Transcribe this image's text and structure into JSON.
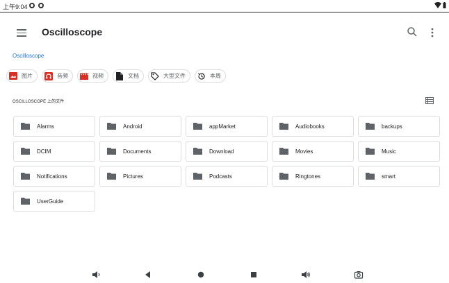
{
  "status_bar": {
    "time": "上午9:04",
    "icons": [
      "app-notification-icon",
      "app-notification-icon",
      "wifi-icon",
      "battery-icon"
    ]
  },
  "app_bar": {
    "title": "Oscilloscope",
    "icons": [
      "menu-icon",
      "search-icon",
      "more-vert-icon"
    ]
  },
  "breadcrumb": {
    "label": "Oscilloscope"
  },
  "chips": [
    {
      "label": "图片",
      "icon": "image-icon",
      "color": "#d93025"
    },
    {
      "label": "音频",
      "icon": "headphones-icon",
      "color": "#d93025"
    },
    {
      "label": "视频",
      "icon": "movie-icon",
      "color": "#d93025"
    },
    {
      "label": "文档",
      "icon": "document-icon",
      "color": "#202124"
    },
    {
      "label": "大型文件",
      "icon": "label-icon",
      "color": "#202124"
    },
    {
      "label": "本周",
      "icon": "history-icon",
      "color": "#202124"
    }
  ],
  "section": {
    "title": "OSCILLOSCOPE 上的文件",
    "view_icon": "list-view-icon"
  },
  "folders": [
    {
      "name": "Alarms"
    },
    {
      "name": "Android"
    },
    {
      "name": "appMarket"
    },
    {
      "name": "Audiobooks"
    },
    {
      "name": "backups"
    },
    {
      "name": "DCIM"
    },
    {
      "name": "Documents"
    },
    {
      "name": "Download"
    },
    {
      "name": "Movies"
    },
    {
      "name": "Music"
    },
    {
      "name": "Notifications"
    },
    {
      "name": "Pictures"
    },
    {
      "name": "Podcasts"
    },
    {
      "name": "Ringtones"
    },
    {
      "name": "smart"
    },
    {
      "name": "UserGuide"
    }
  ],
  "nav_bar": {
    "icons": [
      "volume-down-icon",
      "back-icon",
      "home-icon",
      "recents-icon",
      "volume-up-icon",
      "screenshot-icon"
    ]
  },
  "colors": {
    "accent": "#1a73e8",
    "folder_icon": "#5f6368",
    "border": "#dadce0"
  }
}
